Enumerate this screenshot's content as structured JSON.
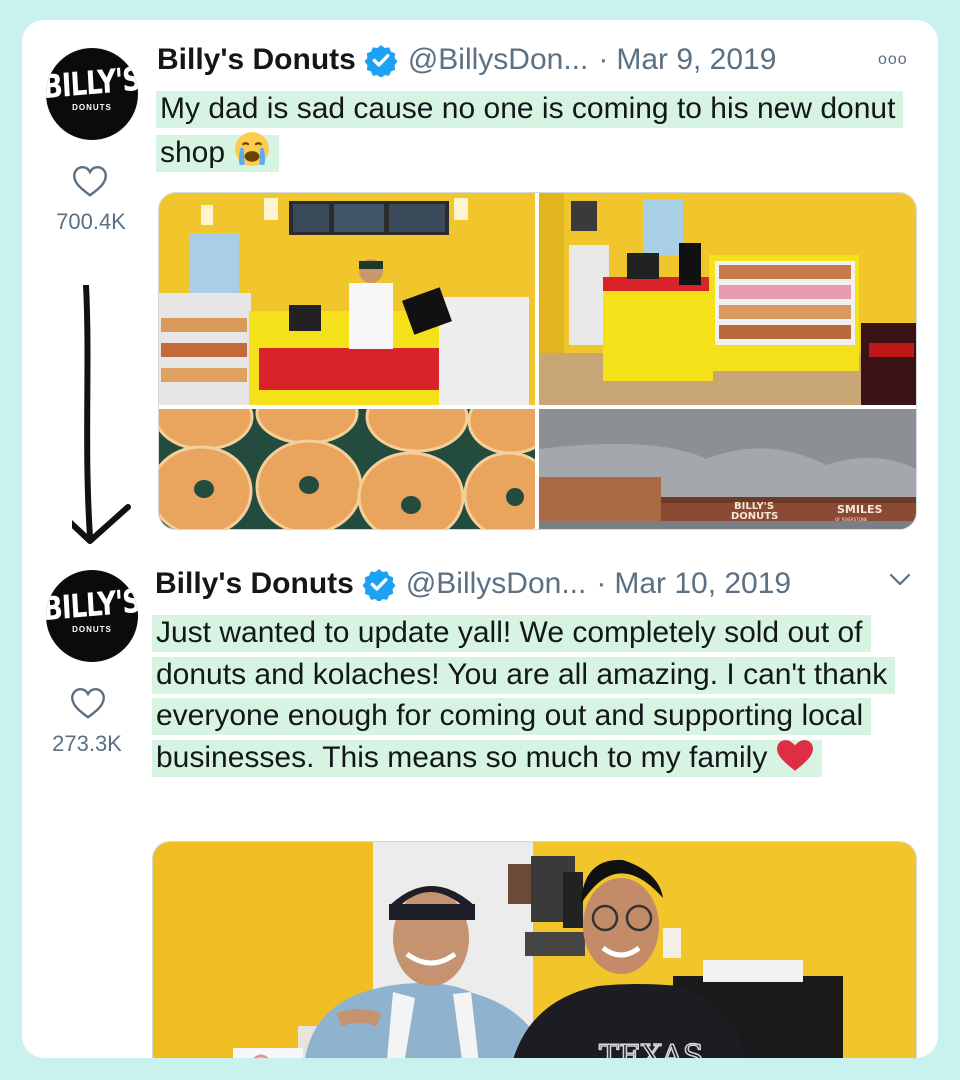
{
  "tweets": [
    {
      "name": "Billy's Donuts",
      "handle": "@BillysDon...",
      "separator": "·",
      "date": "Mar 9, 2019",
      "menu": "ooo",
      "text": "My dad is sad cause no one is coming to his new donut shop",
      "likes": "700.4K",
      "avatar_logo": "BILLY'S",
      "avatar_sub": "DONUTS",
      "sign_left": "BILLY'S\nDONUTS",
      "sign_right": "SMILES",
      "sign_right_sub": "OF RIVERSTONE"
    },
    {
      "name": "Billy's Donuts",
      "handle": "@BillysDon...",
      "separator": "·",
      "date": "Mar 10, 2019",
      "text": "Just wanted to update yall! We completely sold out of donuts and kolaches! You are all amazing. I can't thank everyone enough for coming out and supporting local businesses. This means so much to my family",
      "likes": "273.3K",
      "avatar_logo": "BILLY'S",
      "avatar_sub": "DONUTS",
      "shirt_text": "TEXAS"
    }
  ],
  "colors": {
    "background": "#c9f1ee",
    "highlight": "#d7f4e3",
    "verified": "#1da1f2",
    "muted": "#5b7083",
    "wall_yellow": "#f2c52a",
    "counter_red": "#d8232a"
  },
  "icons": [
    "heart-icon",
    "verified-badge-icon",
    "more-icon",
    "chevron-down-icon",
    "crying-emoji-icon",
    "red-heart-emoji-icon",
    "down-arrow-icon"
  ]
}
